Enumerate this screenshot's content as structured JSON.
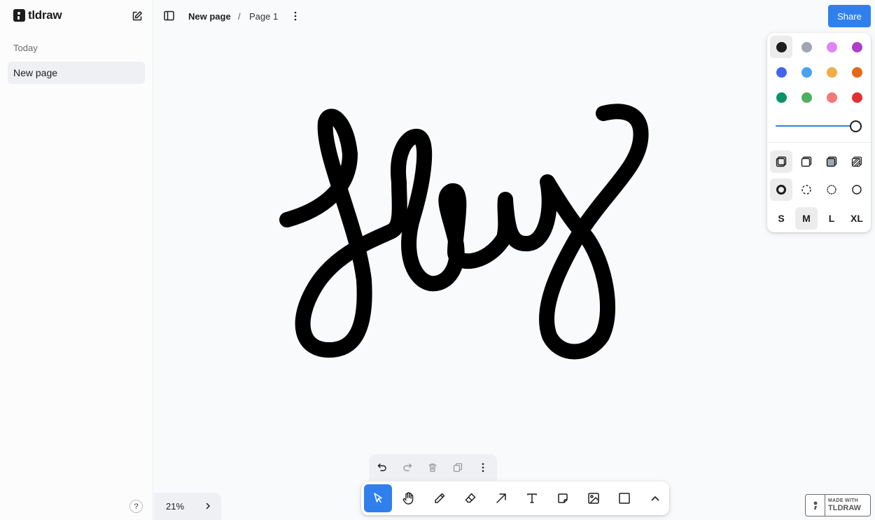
{
  "sidebar": {
    "brand": "tldraw",
    "section_label": "Today",
    "items": [
      {
        "label": "New page",
        "selected": true
      }
    ],
    "help_label": "?"
  },
  "header": {
    "page_name": "New page",
    "separator": "/",
    "current_page": "Page 1",
    "share_label": "Share"
  },
  "canvas": {
    "drawing_description": "hand-drawn black pen stroke",
    "stroke_color": "#000000"
  },
  "style_panel": {
    "colors": [
      {
        "name": "black",
        "hex": "#1d1d1d",
        "selected": true
      },
      {
        "name": "grey",
        "hex": "#9fa8b2"
      },
      {
        "name": "light-violet",
        "hex": "#e085f4"
      },
      {
        "name": "violet",
        "hex": "#ae3ec9"
      },
      {
        "name": "blue",
        "hex": "#4465e9"
      },
      {
        "name": "light-blue",
        "hex": "#4ba1f1"
      },
      {
        "name": "yellow",
        "hex": "#f1ac4b"
      },
      {
        "name": "orange",
        "hex": "#e16919"
      },
      {
        "name": "green",
        "hex": "#099268"
      },
      {
        "name": "light-green",
        "hex": "#4cb05e"
      },
      {
        "name": "light-red",
        "hex": "#f87777"
      },
      {
        "name": "red",
        "hex": "#e03131"
      }
    ],
    "opacity": 1.0,
    "fill_options": [
      "none",
      "semi",
      "solid",
      "pattern"
    ],
    "fill_selected": "none",
    "dash_options": [
      "draw",
      "dashed",
      "dotted",
      "solid"
    ],
    "dash_selected": "draw",
    "sizes": [
      "S",
      "M",
      "L",
      "XL"
    ],
    "size_selected": "M"
  },
  "zoom": {
    "level": "21%"
  },
  "action_bar": [
    "undo",
    "redo",
    "delete",
    "duplicate",
    "more"
  ],
  "toolbar": {
    "tools": [
      "select",
      "hand",
      "draw",
      "eraser",
      "arrow",
      "text",
      "note",
      "asset",
      "rectangle",
      "more"
    ],
    "active": "select"
  },
  "watermark": {
    "line1": "MADE WITH",
    "line2": "TLDRAW"
  },
  "colors": {
    "accent": "#2f80ed",
    "panel_bg": "#ffffff",
    "canvas_bg": "#f9fafb"
  }
}
